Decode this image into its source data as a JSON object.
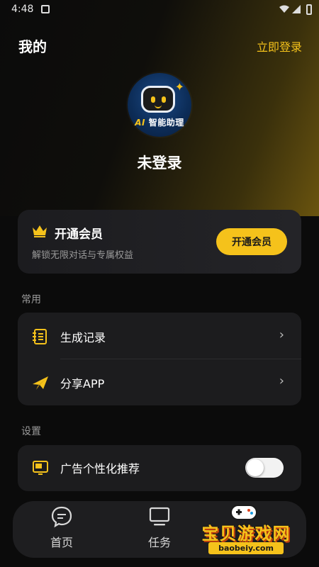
{
  "status_bar": {
    "time": "4:48"
  },
  "header": {
    "title": "我的",
    "login_link": "立即登录"
  },
  "profile": {
    "avatar_brand": "智能助理",
    "avatar_ai": "AI",
    "username": "未登录"
  },
  "vip_card": {
    "title": "开通会员",
    "subtitle": "解锁无限对话与专属权益",
    "button": "开通会员"
  },
  "sections": {
    "common": {
      "label": "常用",
      "items": [
        {
          "label": "生成记录",
          "icon": "notebook-icon"
        },
        {
          "label": "分享APP",
          "icon": "paper-plane-icon"
        }
      ]
    },
    "settings": {
      "label": "设置",
      "items": [
        {
          "label": "广告个性化推荐",
          "icon": "ad-icon",
          "toggle_on": false
        }
      ]
    }
  },
  "bottom_nav": {
    "items": [
      {
        "label": "首页",
        "icon": "chat-bubble-icon"
      },
      {
        "label": "任务",
        "icon": "monitor-icon"
      }
    ]
  },
  "watermark": {
    "text": "宝贝游戏网",
    "url": "baobeiy.com"
  },
  "colors": {
    "accent": "#f5c21b",
    "background": "#0b0b0b",
    "card": "#1c1c1e",
    "muted_text": "#9a9a9a"
  }
}
